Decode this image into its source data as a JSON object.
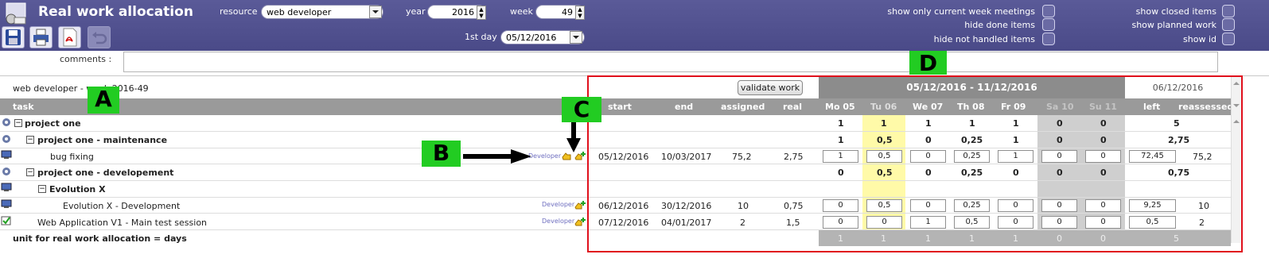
{
  "header": {
    "title": "Real work allocation",
    "resource_label": "resource",
    "resource_value": "web developer",
    "year_label": "year",
    "year_value": "2016",
    "week_label": "week",
    "week_value": "49",
    "first_day_label": "1st day",
    "first_day_value": "05/12/2016"
  },
  "toggles": {
    "current_week_meetings": "show only current week meetings",
    "hide_done": "hide done items",
    "hide_not_handled": "hide not handled items",
    "closed_items": "show closed items",
    "planned_work": "show planned work",
    "show_id": "show id"
  },
  "comments_label": "comments :",
  "panel_title": "web developer - week 2016-49",
  "validate_label": "validate work",
  "period_label": "05/12/2016 - 11/12/2016",
  "current_day_label": "06/12/2016",
  "columns": {
    "task": "task",
    "start": "start",
    "end": "end",
    "assigned": "assigned",
    "real": "real",
    "days": [
      "Mo 05",
      "Tu 06",
      "We 07",
      "Th 08",
      "Fr 09",
      "Sa 10",
      "Su 11"
    ],
    "left": "left",
    "reassessed": "reassessed"
  },
  "rows": [
    {
      "name": "project one",
      "days": [
        "1",
        "1",
        "1",
        "1",
        "1",
        "0",
        "0"
      ],
      "left": "5"
    },
    {
      "name": "project one - maintenance",
      "days": [
        "1",
        "0,5",
        "0",
        "0,25",
        "1",
        "0",
        "0"
      ],
      "left": "2,75"
    },
    {
      "name": "bug fixing",
      "tag": "Developer",
      "start": "05/12/2016",
      "end": "10/03/2017",
      "assigned": "75,2",
      "real": "2,75",
      "days": [
        "1",
        "0,5",
        "0",
        "0,25",
        "1",
        "0",
        "0"
      ],
      "left": "72,45",
      "reassessed": "75,2"
    },
    {
      "name": "project one - developement",
      "days": [
        "0",
        "0,5",
        "0",
        "0,25",
        "0",
        "0",
        "0"
      ],
      "left": "0,75"
    },
    {
      "name": "Evolution X"
    },
    {
      "name": "Evolution X - Development",
      "tag": "Developer",
      "start": "06/12/2016",
      "end": "30/12/2016",
      "assigned": "10",
      "real": "0,75",
      "days": [
        "0",
        "0,5",
        "0",
        "0,25",
        "0",
        "0",
        "0"
      ],
      "left": "9,25",
      "reassessed": "10"
    },
    {
      "name": "Web Application V1 - Main test session",
      "tag": "Developer",
      "start": "07/12/2016",
      "end": "04/01/2017",
      "assigned": "2",
      "real": "1,5",
      "days": [
        "0",
        "0",
        "1",
        "0,5",
        "0",
        "0",
        "0"
      ],
      "left": "0,5",
      "reassessed": "2"
    }
  ],
  "footer": {
    "unit_label": "unit for real work allocation = days",
    "totals": [
      "1",
      "1",
      "1",
      "1",
      "1",
      "0",
      "0"
    ],
    "left_total": "5"
  },
  "annotations": {
    "a": "A",
    "b": "B",
    "c": "C",
    "d": "D"
  },
  "colors": {
    "header_bg": "#4f4f8f",
    "column_head": "#9a9a9a",
    "highlight_today": "#fffaa8",
    "weekend": "#c8c8c8",
    "annotation": "#22cc22",
    "annotation_frame": "#e0101c"
  }
}
